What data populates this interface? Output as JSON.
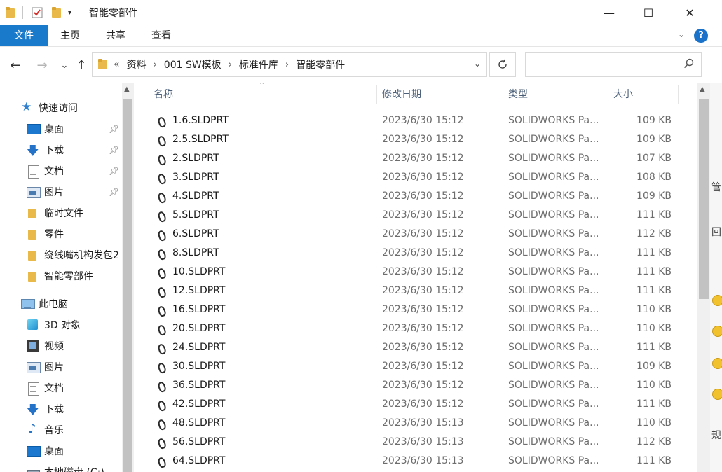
{
  "window": {
    "title": "智能零部件",
    "controls": {
      "minimize": "—",
      "maximize": "☐",
      "close": "✕"
    }
  },
  "ribbon": {
    "tabs": [
      {
        "label": "文件",
        "active": true
      },
      {
        "label": "主页"
      },
      {
        "label": "共享"
      },
      {
        "label": "查看"
      }
    ],
    "help": "?"
  },
  "nav": {
    "back": "←",
    "forward": "→",
    "recent": "⌄",
    "up": "↑",
    "breadcrumb_overflow": "«",
    "breadcrumbs": [
      "资料",
      "001 SW模板",
      "标准件库",
      "智能零部件"
    ],
    "search_placeholder": ""
  },
  "sidebar": {
    "items": [
      {
        "label": "快速访问",
        "icon": "star-icon",
        "pinned": false
      },
      {
        "label": "桌面",
        "icon": "desktop-icon",
        "pinned": true
      },
      {
        "label": "下载",
        "icon": "download-icon",
        "pinned": true
      },
      {
        "label": "文档",
        "icon": "document-icon",
        "pinned": true
      },
      {
        "label": "图片",
        "icon": "pictures-icon",
        "pinned": true
      },
      {
        "label": "临时文件",
        "icon": "folder-icon",
        "pinned": false
      },
      {
        "label": "零件",
        "icon": "folder-icon",
        "pinned": false
      },
      {
        "label": "绕线嘴机构发包2",
        "icon": "folder-icon",
        "pinned": false
      },
      {
        "label": "智能零部件",
        "icon": "folder-icon",
        "pinned": false
      },
      {
        "label": "此电脑",
        "icon": "computer-icon",
        "pinned": false
      },
      {
        "label": "3D 对象",
        "icon": "3d-objects-icon",
        "pinned": false
      },
      {
        "label": "视频",
        "icon": "video-icon",
        "pinned": false
      },
      {
        "label": "图片",
        "icon": "pictures-icon",
        "pinned": false
      },
      {
        "label": "文档",
        "icon": "document-icon",
        "pinned": false
      },
      {
        "label": "下载",
        "icon": "download-icon",
        "pinned": false
      },
      {
        "label": "音乐",
        "icon": "music-icon",
        "pinned": false
      },
      {
        "label": "桌面",
        "icon": "desktop-icon",
        "pinned": false
      },
      {
        "label": "本地磁盘 (C:)",
        "icon": "disk-icon",
        "pinned": false
      }
    ]
  },
  "list": {
    "columns": {
      "name": "名称",
      "date": "修改日期",
      "type": "类型",
      "size": "大小"
    },
    "files": [
      {
        "name": "1.6.SLDPRT",
        "date": "2023/6/30 15:12",
        "type": "SOLIDWORKS Pa...",
        "size": "109 KB"
      },
      {
        "name": "2.5.SLDPRT",
        "date": "2023/6/30 15:12",
        "type": "SOLIDWORKS Pa...",
        "size": "109 KB"
      },
      {
        "name": "2.SLDPRT",
        "date": "2023/6/30 15:12",
        "type": "SOLIDWORKS Pa...",
        "size": "107 KB"
      },
      {
        "name": "3.SLDPRT",
        "date": "2023/6/30 15:12",
        "type": "SOLIDWORKS Pa...",
        "size": "108 KB"
      },
      {
        "name": "4.SLDPRT",
        "date": "2023/6/30 15:12",
        "type": "SOLIDWORKS Pa...",
        "size": "109 KB"
      },
      {
        "name": "5.SLDPRT",
        "date": "2023/6/30 15:12",
        "type": "SOLIDWORKS Pa...",
        "size": "111 KB"
      },
      {
        "name": "6.SLDPRT",
        "date": "2023/6/30 15:12",
        "type": "SOLIDWORKS Pa...",
        "size": "112 KB"
      },
      {
        "name": "8.SLDPRT",
        "date": "2023/6/30 15:12",
        "type": "SOLIDWORKS Pa...",
        "size": "111 KB"
      },
      {
        "name": "10.SLDPRT",
        "date": "2023/6/30 15:12",
        "type": "SOLIDWORKS Pa...",
        "size": "111 KB"
      },
      {
        "name": "12.SLDPRT",
        "date": "2023/6/30 15:12",
        "type": "SOLIDWORKS Pa...",
        "size": "111 KB"
      },
      {
        "name": "16.SLDPRT",
        "date": "2023/6/30 15:12",
        "type": "SOLIDWORKS Pa...",
        "size": "110 KB"
      },
      {
        "name": "20.SLDPRT",
        "date": "2023/6/30 15:12",
        "type": "SOLIDWORKS Pa...",
        "size": "110 KB"
      },
      {
        "name": "24.SLDPRT",
        "date": "2023/6/30 15:12",
        "type": "SOLIDWORKS Pa...",
        "size": "111 KB"
      },
      {
        "name": "30.SLDPRT",
        "date": "2023/6/30 15:12",
        "type": "SOLIDWORKS Pa...",
        "size": "109 KB"
      },
      {
        "name": "36.SLDPRT",
        "date": "2023/6/30 15:12",
        "type": "SOLIDWORKS Pa...",
        "size": "110 KB"
      },
      {
        "name": "42.SLDPRT",
        "date": "2023/6/30 15:12",
        "type": "SOLIDWORKS Pa...",
        "size": "111 KB"
      },
      {
        "name": "48.SLDPRT",
        "date": "2023/6/30 15:13",
        "type": "SOLIDWORKS Pa...",
        "size": "110 KB"
      },
      {
        "name": "56.SLDPRT",
        "date": "2023/6/30 15:13",
        "type": "SOLIDWORKS Pa...",
        "size": "112 KB"
      },
      {
        "name": "64.SLDPRT",
        "date": "2023/6/30 15:13",
        "type": "SOLIDWORKS Pa...",
        "size": "111 KB"
      }
    ]
  },
  "peek": {
    "texts": [
      "管",
      "回",
      "规"
    ]
  },
  "colors": {
    "accent": "#1979ca",
    "folder": "#e9b949",
    "muted_text": "#6d6d6d"
  }
}
